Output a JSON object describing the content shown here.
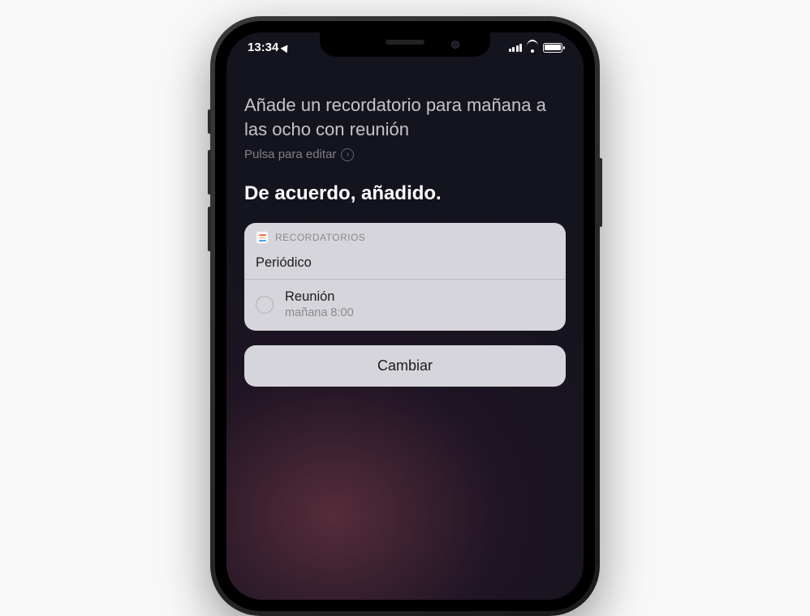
{
  "status": {
    "time": "13:34"
  },
  "siri": {
    "user_request": "Añade un recordatorio para mañana a las ocho con reunión",
    "edit_hint": "Pulsa para editar",
    "response": "De acuerdo, añadido."
  },
  "card": {
    "app_label": "RECORDATORIOS",
    "list_name": "Periódico",
    "reminder": {
      "title": "Reunión",
      "subtitle": "mañana 8:00"
    }
  },
  "actions": {
    "change": "Cambiar"
  }
}
